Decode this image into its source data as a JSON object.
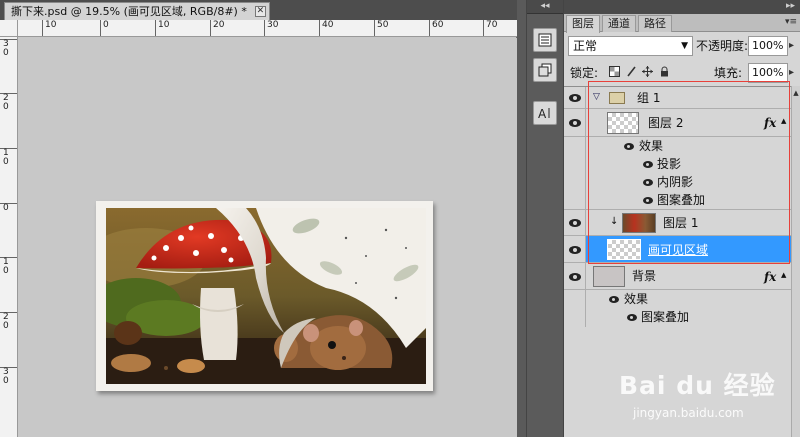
{
  "document": {
    "tab_title": "撕下来.psd @ 19.5% (画可见区域, RGB/8#) *",
    "close_glyph": "✕",
    "ruler_top_labels": [
      "10",
      "0",
      "10",
      "20",
      "30",
      "40",
      "50",
      "60",
      "70"
    ],
    "ruler_left_labels": [
      "3\n0",
      "2\n0",
      "1\n0",
      "0",
      "1\n0",
      "2\n0",
      "3\n0"
    ]
  },
  "dock": {
    "collapse_glyph": "◂◂",
    "icons": [
      "layers-panel-icon",
      "channels-panel-icon",
      "character-panel-icon"
    ]
  },
  "panel": {
    "collapse_glyph": "▸▸",
    "tabs": [
      "图层",
      "通道",
      "路径"
    ],
    "active_tab": "图层",
    "menu_glyph": "▾≡",
    "blend_mode": "正常",
    "opacity_label": "不透明度:",
    "opacity_value": "100%",
    "lock_label": "锁定:",
    "fill_label": "填充:",
    "fill_value": "100%",
    "layers": [
      {
        "name": "组 1",
        "kind": "group"
      },
      {
        "name": "图层 2",
        "kind": "layer",
        "fx": "fx"
      },
      {
        "name": "效果",
        "kind": "effects-header"
      },
      {
        "name": "投影",
        "kind": "effect"
      },
      {
        "name": "内阴影",
        "kind": "effect"
      },
      {
        "name": "图案叠加",
        "kind": "effect"
      },
      {
        "name": "图层 1",
        "kind": "clipped-layer"
      },
      {
        "name": "画可见区域",
        "kind": "layer",
        "selected": true
      },
      {
        "name": "背景",
        "kind": "background",
        "fx": "fx"
      },
      {
        "name": "效果",
        "kind": "effects-header"
      },
      {
        "name": "图案叠加",
        "kind": "effect"
      }
    ]
  },
  "watermark": {
    "title": "Bai du 经验",
    "url": "jingyan.baidu.com"
  },
  "colors": {
    "selection": "#3399ff",
    "highlight_border": "#e8403a",
    "panel_bg": "#d6d6d6",
    "canvas_bg": "#c8c8c8"
  }
}
